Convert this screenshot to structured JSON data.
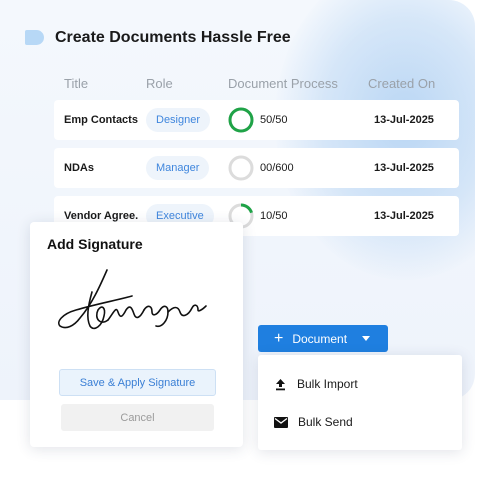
{
  "header": {
    "title": "Create Documents Hassle Free",
    "icon": "folder-tab-icon"
  },
  "table": {
    "columns": [
      "Title",
      "Role",
      "Document Process",
      "Created On"
    ],
    "rows": [
      {
        "title": "Emp Contacts",
        "role": "Designer",
        "process": "50/50",
        "completed": 50,
        "total": 50,
        "created": "13-Jul-2025"
      },
      {
        "title": "NDAs",
        "role": "Manager",
        "process": "00/600",
        "completed": 0,
        "total": 600,
        "created": "13-Jul-2025"
      },
      {
        "title": "Vendor Agree.",
        "role": "Executive",
        "process": "10/50",
        "completed": 10,
        "total": 50,
        "created": "13-Jul-2025"
      }
    ]
  },
  "signature_dialog": {
    "title": "Add Signature",
    "save_label": "Save  & Apply Signature",
    "cancel_label": "Cancel"
  },
  "document_menu": {
    "button_label": "Document",
    "items": [
      {
        "label": "Bulk Import",
        "icon": "upload-icon"
      },
      {
        "label": "Bulk Send",
        "icon": "envelope-icon"
      }
    ]
  },
  "colors": {
    "accent": "#1f7fe0",
    "progress_complete": "#1fa347",
    "progress_track": "#dcdcdc",
    "role_text": "#3f86dd"
  }
}
